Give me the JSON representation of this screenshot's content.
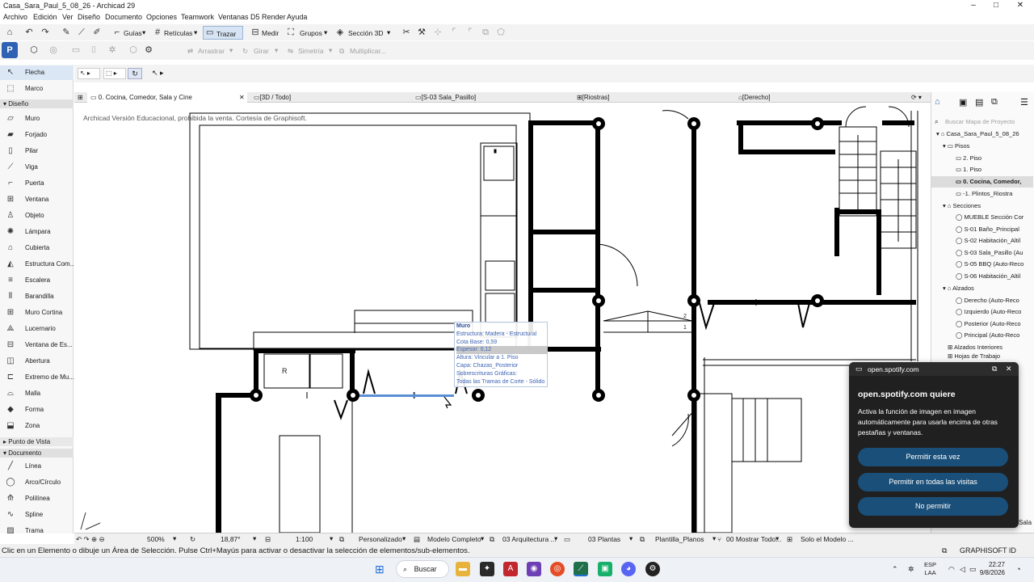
{
  "window": {
    "title": "Casa_Sara_Paul_5_08_26 - Archicad 29",
    "minimize": "–",
    "maximize": "□",
    "close": "✕"
  },
  "menu": [
    "Archivo",
    "Edición",
    "Ver",
    "Diseño",
    "Documento",
    "Opciones",
    "Teamwork",
    "Ventanas",
    "D5 Render",
    "Ayuda"
  ],
  "toolbar1": {
    "guias": "Guías",
    "reticulas": "Retículas",
    "trazar": "Trazar",
    "medir": "Medir",
    "grupos": "Grupos",
    "seccion3d": "Sección 3D"
  },
  "toolbar2": {
    "arrastrar": "Arrastrar",
    "girar": "Girar",
    "simetria": "Simetría",
    "multiplicar": "Multiplicar..."
  },
  "left_tools": {
    "flecha": "Flecha",
    "marco": "Marco",
    "diseno": "Diseño",
    "muro": "Muro",
    "forjado": "Forjado",
    "pilar": "Pilar",
    "viga": "Viga",
    "puerta": "Puerta",
    "ventana": "Ventana",
    "objeto": "Objeto",
    "lampara": "Lámpara",
    "cubierta": "Cubierta",
    "estructura": "Estructura Com...",
    "escalera": "Escalera",
    "barandilla": "Barandilla",
    "muro_cortina": "Muro Cortina",
    "lucernario": "Lucernario",
    "ventana_es": "Ventana de Es...",
    "abertura": "Abertura",
    "extremo": "Extremo de Mu...",
    "malla": "Malla",
    "forma": "Forma",
    "zona": "Zona",
    "punto_vista": "Punto de Vista",
    "documento": "Documento",
    "linea": "Línea",
    "arco": "Arco/Círculo",
    "polilinea": "Polilínea",
    "spline": "Spline",
    "trama": "Trama"
  },
  "tabs": {
    "t1": "0. Cocina, Comedor, Sala y Cine",
    "t2": "[3D / Todo]",
    "t3": "[S-03 Sala_Pasillo]",
    "t4": "[Riostras]",
    "t5": "[Derecho]"
  },
  "watermark": "Archicad Versión Educacional, prohibida la venta. Cortesía de Graphisoft.",
  "tooltip": {
    "title": "Muro",
    "l1": "Estructura: Madera - Estructural",
    "l2": "Cota Base: 0,59",
    "l3": "Espesor: 0,12",
    "l4": "Altura: Vincular a 1. Piso",
    "l5": "Capa: Chazas_Posterior",
    "l6": "Sobrescrituras Gráficas:",
    "l7": "Todas las Tramas de Corte - Sólido"
  },
  "drawing_labels": {
    "r": "R",
    "one": "1",
    "two": "2"
  },
  "navigator": {
    "search": "Buscar Mapa de Proyecto",
    "project": "Casa_Sara_Paul_5_08_26",
    "pisos": "Pisos",
    "p2": "2. Piso",
    "p1": "1. Piso",
    "p0": "0. Cocina, Comedor,",
    "pm1": "-1. Plintos_Riostra",
    "secciones": "Secciones",
    "s0": "MUEBLE Sección Cor",
    "s1": "S-01 Baño_Principal",
    "s2": "S-02 Habitación_Altil",
    "s3": "S-03 Sala_Pasillo (Au",
    "s5": "S-05 BBQ (Auto-Reco",
    "s6": "S-06 Habitación_Altil",
    "alzados": "Alzados",
    "a1": "Derecho (Auto-Reco",
    "a2": "Izquierdo (Auto-Reco",
    "a3": "Posterior (Auto-Reco",
    "a4": "Principal (Auto-Reco",
    "ai": "Alzados Interiores",
    "hojas": "Hojas de Trabajo",
    "sala": "Sala"
  },
  "statusbar": {
    "zoom": "500%",
    "angle": "18,87°",
    "scale": "1:100",
    "override": "Personalizado",
    "model": "Modelo Completo",
    "arq": "03 Arquitectura ...",
    "plantas": "03 Plantas",
    "plantilla": "Plantilla_Planos",
    "mostrar": "00 Mostrar Todo...",
    "solo": "Solo el Modelo ...",
    "graphisoft": "GRAPHISOFT ID"
  },
  "hint": "Clic en un Elemento o dibuje un Área de Selección. Pulse Ctrl+Mayús para activar o desactivar la selección de elementos/sub-elementos.",
  "taskbar": {
    "search": "Buscar",
    "lang1": "ESP",
    "lang2": "LAA",
    "time": "22:27",
    "date": "9/8/2026"
  },
  "popup": {
    "domain": "open.spotify.com",
    "title": "open.spotify.com quiere",
    "body": "Activa la función de imagen en imagen automáticamente para usarla encima de otras pestañas y ventanas.",
    "b1": "Permitir esta vez",
    "b2": "Permitir en todas las visitas",
    "b3": "No permitir"
  },
  "colors": {
    "accent": "#3d64b4",
    "popup_button": "#1a4f79",
    "popup_bg": "#202020"
  }
}
